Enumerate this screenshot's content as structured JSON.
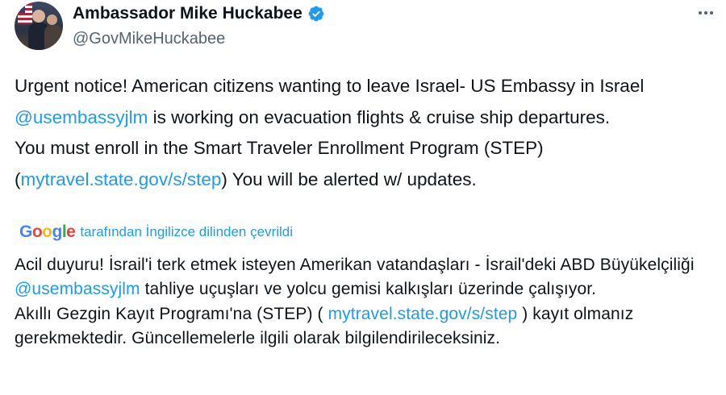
{
  "author": {
    "display_name": "Ambassador Mike Huckabee",
    "handle": "@GovMikeHuckabee",
    "verified_icon": "verified-badge-icon",
    "verified_color": "#1d9bf0"
  },
  "tweet": {
    "line1_text": "Urgent notice! American citizens wanting to leave Israel-  US Embassy in Israel ",
    "mention": "@usembassyjlm",
    "line1_rest": " is working on evacuation flights & cruise ship departures.",
    "line2_text": "You must enroll in the Smart Traveler Enrollment Program (STEP) (",
    "link": "mytravel.state.gov/s/step",
    "line2_rest": ") You will be alerted w/ updates."
  },
  "translation": {
    "provider": "Google",
    "note": "tarafından İngilizce dilinden çevrildi",
    "line1_text": "Acil duyuru! İsrail'i terk etmek isteyen Amerikan vatandaşları - İsrail'deki ABD Büyükelçiliği ",
    "mention": "@usembassyjlm",
    "line1_rest": " tahliye uçuşları ve yolcu gemisi kalkışları üzerinde çalışıyor.",
    "line2_text": "Akıllı Gezgin Kayıt Programı'na (STEP) ( ",
    "link": "mytravel.state.gov/s/step",
    "line2_rest": " ) kayıt olmanız gerekmektedir. Güncellemelerle ilgili olarak bilgilendirileceksiniz."
  },
  "colors": {
    "text": "#0f1419",
    "secondary": "#536471",
    "link": "#1d9bf0"
  }
}
